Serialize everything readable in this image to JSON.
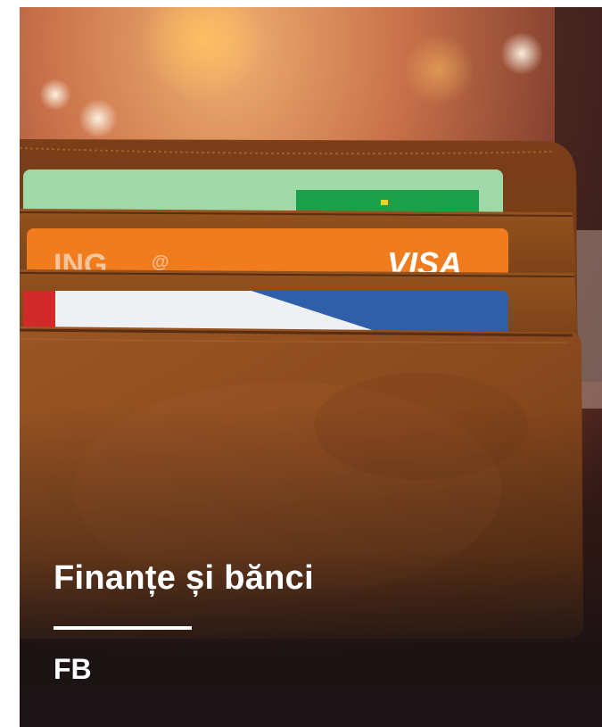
{
  "card": {
    "title": "Finanțe și bănci",
    "code": "FB"
  },
  "photo": {
    "subject": "wallet-with-cards",
    "cards": [
      {
        "name": "green-card"
      },
      {
        "name": "orange-card",
        "brand_text": "VISA",
        "bank_text": "ING"
      },
      {
        "name": "white-blue-card"
      }
    ]
  },
  "colors": {
    "leather": "#8a4a1e",
    "overlay": "#1c1416",
    "text": "#ffffff",
    "orange_card": "#f07c1e",
    "green_card": "#9fd9a8",
    "blue_card": "#2f5fa8"
  }
}
